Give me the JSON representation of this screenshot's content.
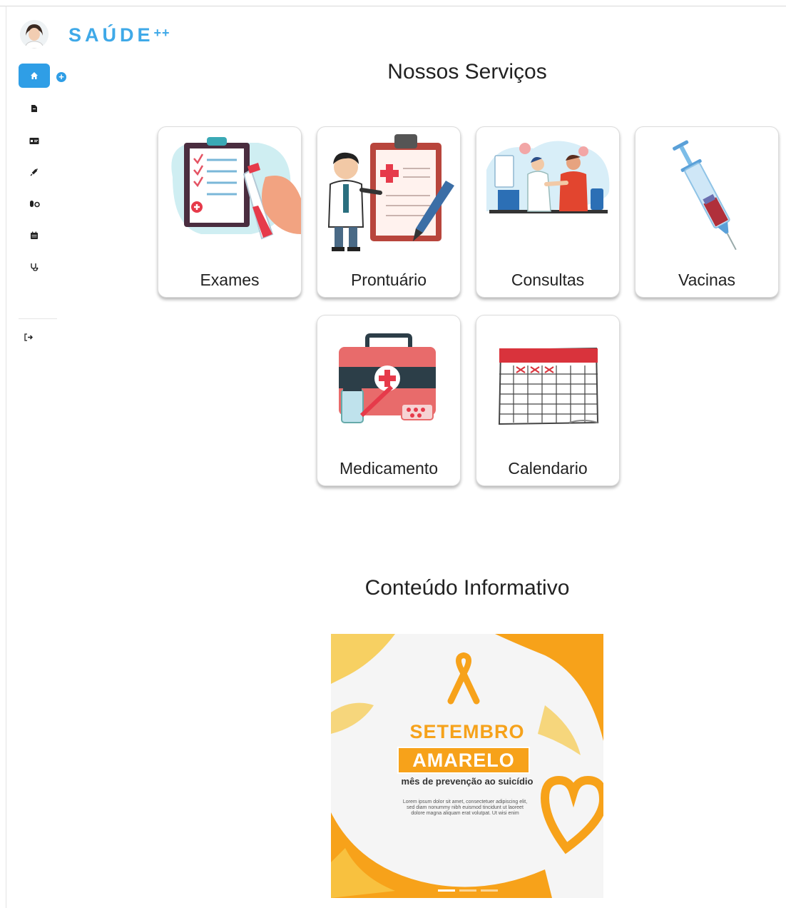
{
  "header": {
    "brand": "SAÚDE",
    "brand_plus": "++"
  },
  "sidebar": {
    "items": [
      {
        "name": "home-icon",
        "active": true
      },
      {
        "name": "document-icon"
      },
      {
        "name": "id-card-icon"
      },
      {
        "name": "syringe-icon"
      },
      {
        "name": "pills-icon"
      },
      {
        "name": "calendar-icon"
      },
      {
        "name": "stethoscope-icon"
      }
    ],
    "logout_icon": "logout-icon",
    "add_icon": "add-circle-icon"
  },
  "services": {
    "title": "Nossos Serviços",
    "cards": [
      {
        "label": "Exames"
      },
      {
        "label": "Prontuário"
      },
      {
        "label": "Consultas"
      },
      {
        "label": "Vacinas"
      },
      {
        "label": "Medicamento"
      },
      {
        "label": "Calendario"
      }
    ]
  },
  "info": {
    "title": "Conteúdo Informativo",
    "banner": {
      "line1": "SETEMBRO",
      "line2": "AMARELO",
      "subtitle": "mês de prevenção ao suicídio",
      "body": "Lorem ipsum dolor sit amet, consectetuer adipiscing elit, sed diam nonummy nibh euismod tincidunt ut laoreet dolore magna aliquam erat volutpat. Ut wisi enim",
      "slides": 3,
      "active_slide": 1
    }
  },
  "colors": {
    "accent": "#2f9ee6",
    "brand": "#3fa9e8",
    "ribbon": "#f7a21a"
  }
}
